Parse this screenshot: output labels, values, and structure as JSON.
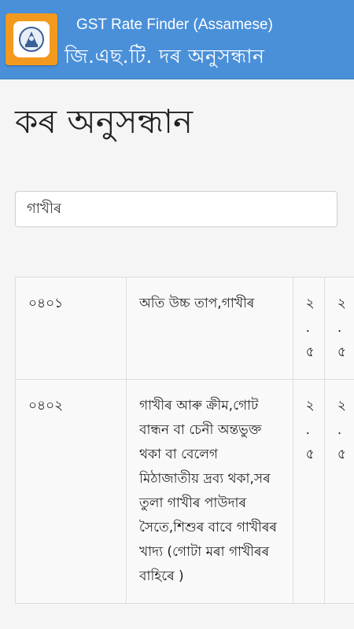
{
  "header": {
    "title_en": "GST Rate Finder (Assamese)",
    "title_as": "জি.এছ.টি. দৰ অনুসন্ধান",
    "logo_icon": "emblem-logo-icon",
    "logo_bg": "#f39a1e",
    "bar_color": "#4a90d9"
  },
  "main": {
    "title": "কৰ অনুসন্ধান",
    "search": {
      "value": "গাখীৰ",
      "placeholder": ""
    }
  },
  "results": {
    "rows": [
      {
        "code": "০৪০১",
        "description": "অতি উচ্চ তাপ,গাখীৰ",
        "rate1": "২.৫",
        "rate2": "২.৫"
      },
      {
        "code": "০৪০২",
        "description": "গাখীৰ আৰু ক্ৰীম,গোট বান্ধন বা চেনী অন্তভুক্ত থকা বা বেলেগ মিঠাজাতীয় দ্ৰব্য থকা,সৰ তুলা গাখীৰ পাউদাৰ সৈতে,শিশুৰ বাবে গাখীৰৰ খাদ্য (গোটা মৰা গাখীৰৰ বাহিৰে )",
        "rate1": "২.৫",
        "rate2": "২.৫"
      }
    ]
  }
}
